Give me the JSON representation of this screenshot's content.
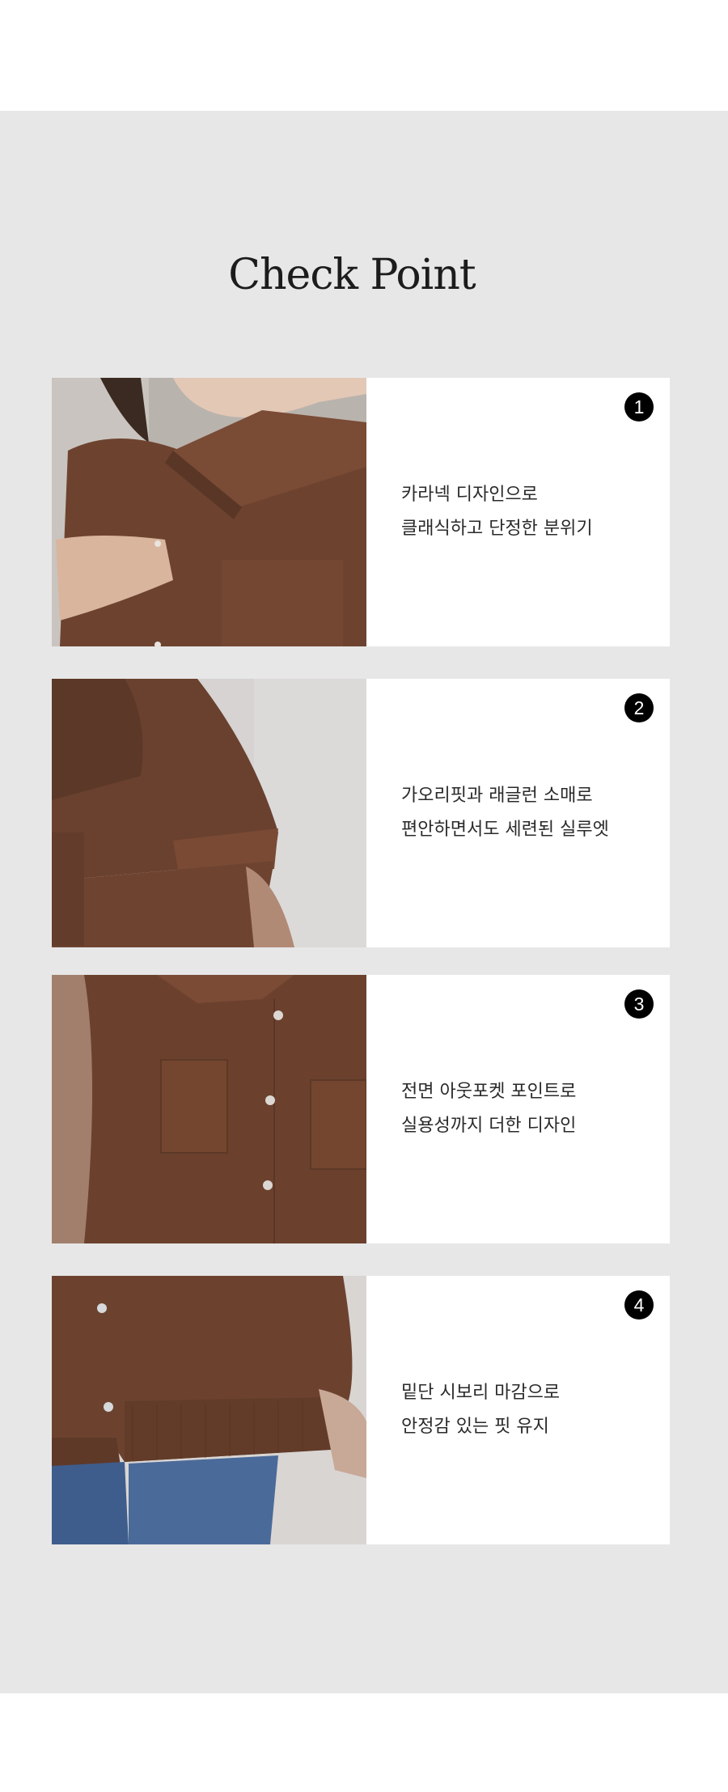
{
  "title": "Check Point",
  "colors": {
    "background": "#ffffff",
    "section": "#e7e7e7",
    "card": "#ffffff",
    "badge": "#000000",
    "knit": "#6b3f2a"
  },
  "points": [
    {
      "number": "1",
      "line1": "카라넥 디자인으로",
      "line2": "클래식하고 단정한 분위기",
      "image": "collar-detail-photo"
    },
    {
      "number": "2",
      "line1": "가오리핏과 래글런 소매로",
      "line2": "편안하면서도 세련된 실루엣",
      "image": "sleeve-detail-photo"
    },
    {
      "number": "3",
      "line1": "전면 아웃포켓 포인트로",
      "line2": "실용성까지 더한 디자인",
      "image": "pocket-detail-photo"
    },
    {
      "number": "4",
      "line1": "밑단 시보리 마감으로",
      "line2": "안정감 있는 핏 유지",
      "image": "hem-detail-photo"
    }
  ]
}
